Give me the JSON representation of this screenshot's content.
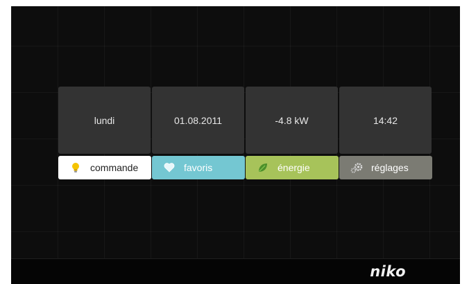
{
  "tiles": {
    "day": "lundi",
    "date": "01.08.2011",
    "power": "-4.8 kW",
    "time": "14:42"
  },
  "tabs": [
    {
      "label": "commande",
      "icon": "lightbulb-icon",
      "color": "#ffffff"
    },
    {
      "label": "favoris",
      "icon": "heart-icon",
      "color": "#74c7d2"
    },
    {
      "label": "énergie",
      "icon": "leaf-icon",
      "color": "#a7c35a"
    },
    {
      "label": "réglages",
      "icon": "gears-icon",
      "color": "#7b7b73"
    }
  ],
  "footer": {
    "brand": "niko"
  }
}
